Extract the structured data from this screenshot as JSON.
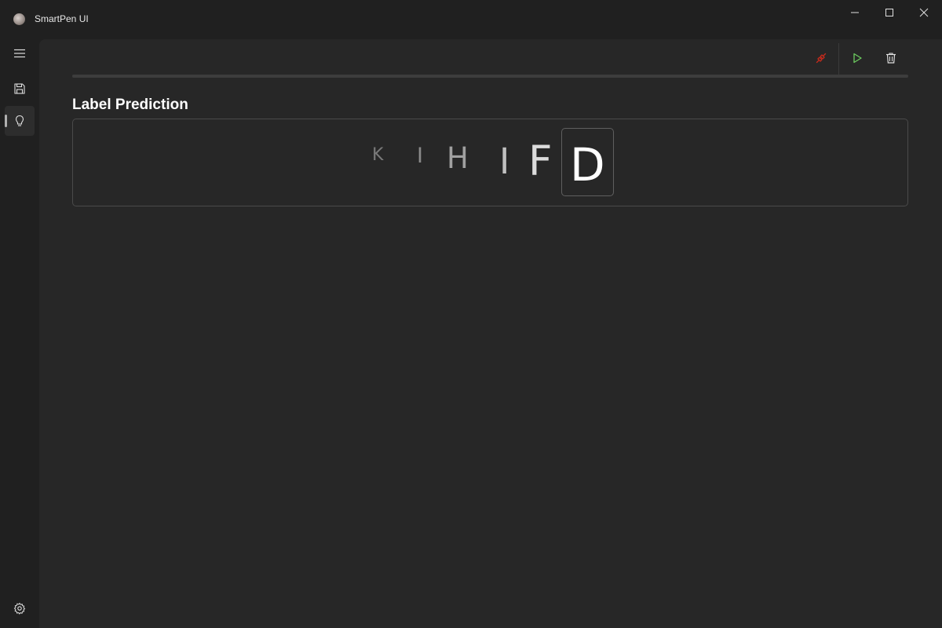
{
  "window": {
    "title": "SmartPen UI"
  },
  "nav": {
    "items": [
      {
        "name": "menu",
        "icon": "hamburger-menu-icon"
      },
      {
        "name": "save",
        "icon": "save-icon"
      },
      {
        "name": "prediction",
        "icon": "lightbulb-icon",
        "selected": true
      }
    ],
    "footer": {
      "icon": "gear-icon"
    }
  },
  "toolbar": {
    "connection_icon": "disconnected-link-icon",
    "connection_color": "#c42b1c",
    "play_icon": "play-icon",
    "play_color": "#6ccb5f",
    "delete_icon": "trash-icon"
  },
  "main": {
    "section_title": "Label Prediction",
    "predictions": [
      "K",
      "I",
      "H",
      "I",
      "F",
      "D"
    ],
    "current_prediction": "D"
  }
}
